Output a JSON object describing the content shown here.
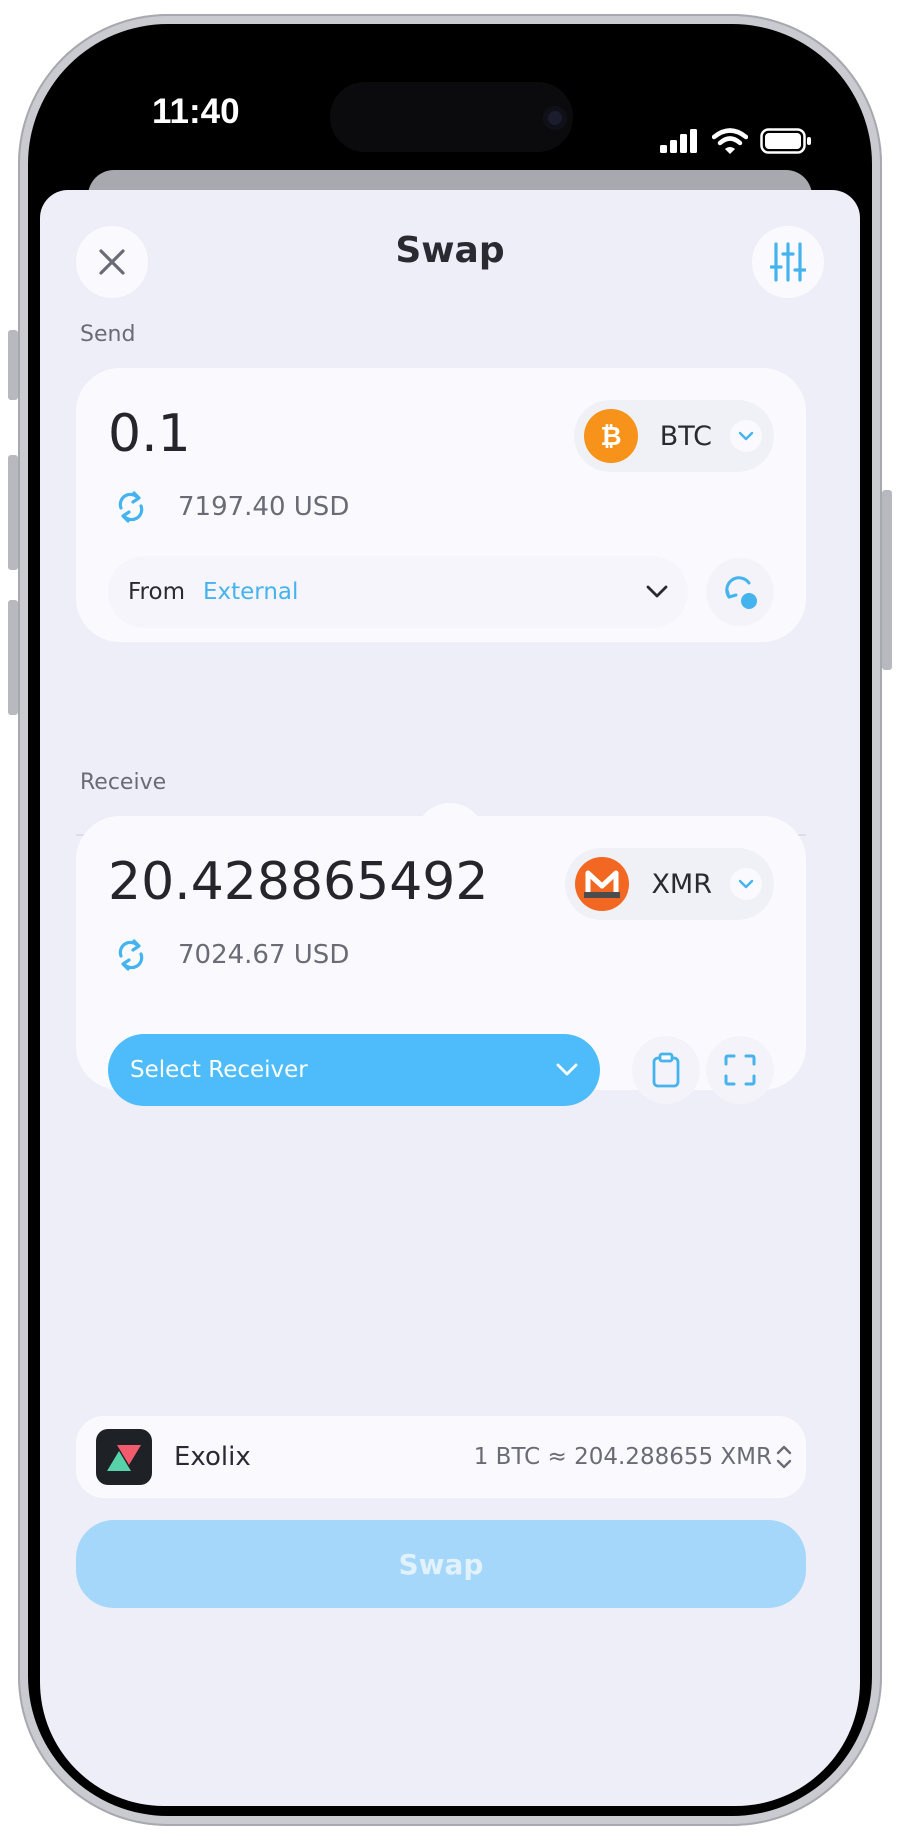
{
  "status_bar": {
    "time": "11:40"
  },
  "header": {
    "title": "Swap",
    "close_icon": "close-icon",
    "settings_icon": "sliders-icon"
  },
  "send": {
    "label": "Send",
    "amount": "0.1",
    "coin": {
      "symbol": "BTC",
      "icon": "bitcoin-icon",
      "color": "#f7931a"
    },
    "fiat_value": "7197.40 USD",
    "from_label": "From",
    "from_value": "External"
  },
  "receive": {
    "label": "Receive",
    "amount": "20.428865492",
    "coin": {
      "symbol": "XMR",
      "icon": "monero-icon",
      "color": "#f26822"
    },
    "fiat_value": "7024.67 USD",
    "select_receiver_label": "Select Receiver"
  },
  "provider": {
    "name": "Exolix",
    "rate": "1 BTC ≈ 204.288655 XMR"
  },
  "swap_button_label": "Swap",
  "colors": {
    "accent": "#4ebcfa",
    "accent_text": "#45b3ee",
    "sheet_bg": "#eeeef8",
    "swap_disabled": "#a4d7fa"
  }
}
